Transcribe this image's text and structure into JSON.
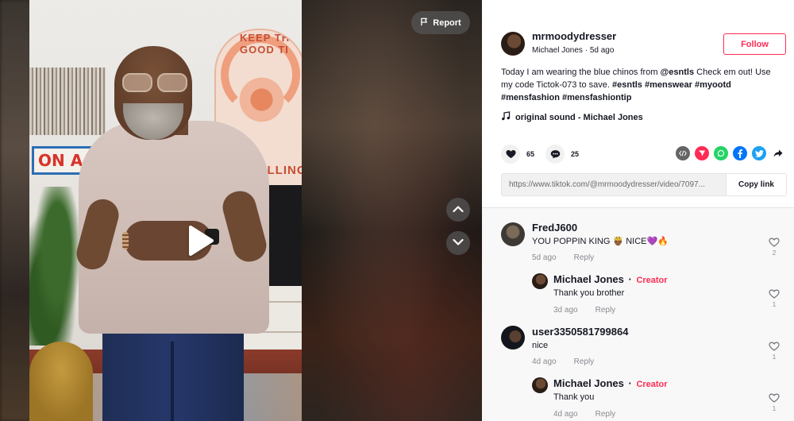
{
  "video": {
    "report_label": "Report",
    "poster_top": "KEEP THE GOOD TI",
    "poster_bottom": "ROLLING",
    "sign_text": "ON A"
  },
  "author": {
    "handle": "mrmoodydresser",
    "display_name": "Michael Jones",
    "posted": "5d ago",
    "follow_label": "Follow"
  },
  "description": {
    "text_1": "Today I am wearing the blue chinos from ",
    "mention": "@esntls",
    "text_2": " Check em out! Use my code Tictok-073 to save. ",
    "hashtags": [
      "#esntls",
      "#menswear",
      "#myootd",
      "#mensfashion",
      "#mensfashiontip"
    ]
  },
  "sound": {
    "label": "original sound - Michael Jones"
  },
  "stats": {
    "likes": "65",
    "comments": "25"
  },
  "share_icons": [
    "embed-icon",
    "send-to-friends-icon",
    "whatsapp-icon",
    "facebook-icon",
    "twitter-icon",
    "share-arrow-icon"
  ],
  "copy_link": {
    "url": "https://www.tiktok.com/@mrmoodydresser/video/7097...",
    "button_label": "Copy link"
  },
  "comments": [
    {
      "name": "FredJ600",
      "text": "YOU POPPIN KING 🤴🏾 NICE💜🔥",
      "time": "5d ago",
      "reply_label": "Reply",
      "likes": "2"
    },
    {
      "name": "Michael Jones",
      "badge": "Creator",
      "text": "Thank you brother",
      "time": "3d ago",
      "reply_label": "Reply",
      "likes": "1"
    },
    {
      "name": "user3350581799864",
      "text": "nice",
      "time": "4d ago",
      "reply_label": "Reply",
      "likes": "1"
    },
    {
      "name": "Michael Jones",
      "badge": "Creator",
      "text": "Thank you",
      "time": "4d ago",
      "reply_label": "Reply",
      "likes": "1"
    }
  ],
  "colors": {
    "accent": "#fe2c55",
    "text": "#161823",
    "muted": "#8a8b91"
  }
}
